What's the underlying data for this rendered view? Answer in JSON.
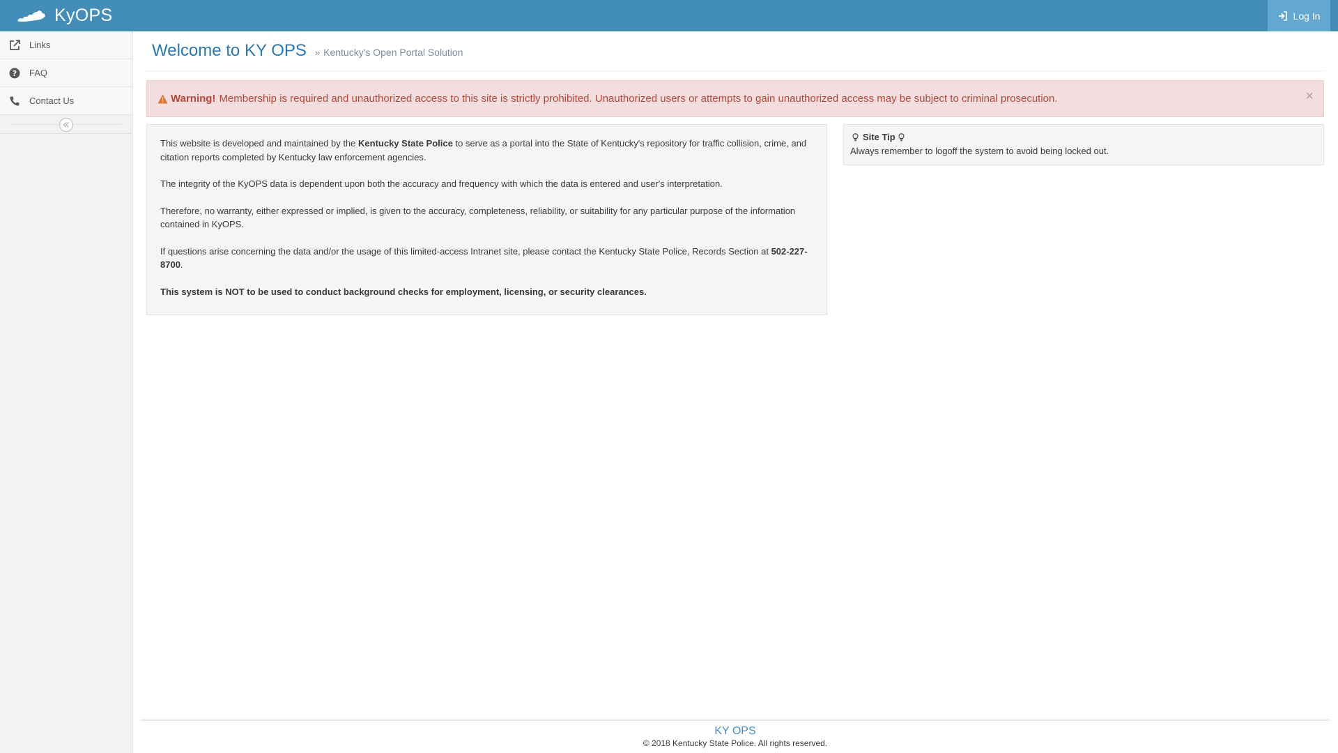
{
  "app": {
    "brand": "KyOPS",
    "login_label": "Log In"
  },
  "sidebar": {
    "items": [
      {
        "label": "Links",
        "icon": "external-link-icon"
      },
      {
        "label": "FAQ",
        "icon": "question-circle-icon"
      },
      {
        "label": "Contact Us",
        "icon": "phone-icon"
      }
    ],
    "collapse_icon": "double-chevron-left-icon"
  },
  "header": {
    "title": "Welcome to KY OPS",
    "subtitle": "Kentucky's Open Portal Solution"
  },
  "alert": {
    "strong": "Warning!",
    "message": "Membership is required and unauthorized access to this site is strictly prohibited. Unauthorized users or attempts to gain unauthorized access may be subject to criminal prosecution.",
    "close": "×"
  },
  "info": {
    "p1_before": "This website is developed and maintained by the ",
    "p1_bold": "Kentucky State Police",
    "p1_after": " to serve as a portal into the State of Kentucky's repository for traffic collision, crime, and citation reports completed by Kentucky law enforcement agencies.",
    "p2": "The integrity of the KyOPS data is dependent upon both the accuracy and frequency with which the data is entered and user's interpretation.",
    "p3": "Therefore, no warranty, either expressed or implied, is given to the accuracy, completeness, reliability, or suitability for any particular purpose of the information contained in KyOPS.",
    "p4_before": "If questions arise concerning the data and/or the usage of this limited-access Intranet site, please contact the Kentucky State Police, Records Section at ",
    "p4_phone": "502-227-8700",
    "p4_after": ".",
    "p5": "This system is NOT to be used to conduct background checks for employment, licensing, or security clearances."
  },
  "site_tip": {
    "title": "Site Tip",
    "text": "Always remember to logoff the system to avoid being locked out."
  },
  "footer": {
    "brand": "KY OPS",
    "copyright": "© 2018 Kentucky State Police. All rights reserved."
  },
  "colors": {
    "navbar": "#438eb9",
    "login_button": "#62a8d1",
    "title": "#2679b5",
    "alert_bg": "#f2dede",
    "alert_text": "#b74635"
  }
}
